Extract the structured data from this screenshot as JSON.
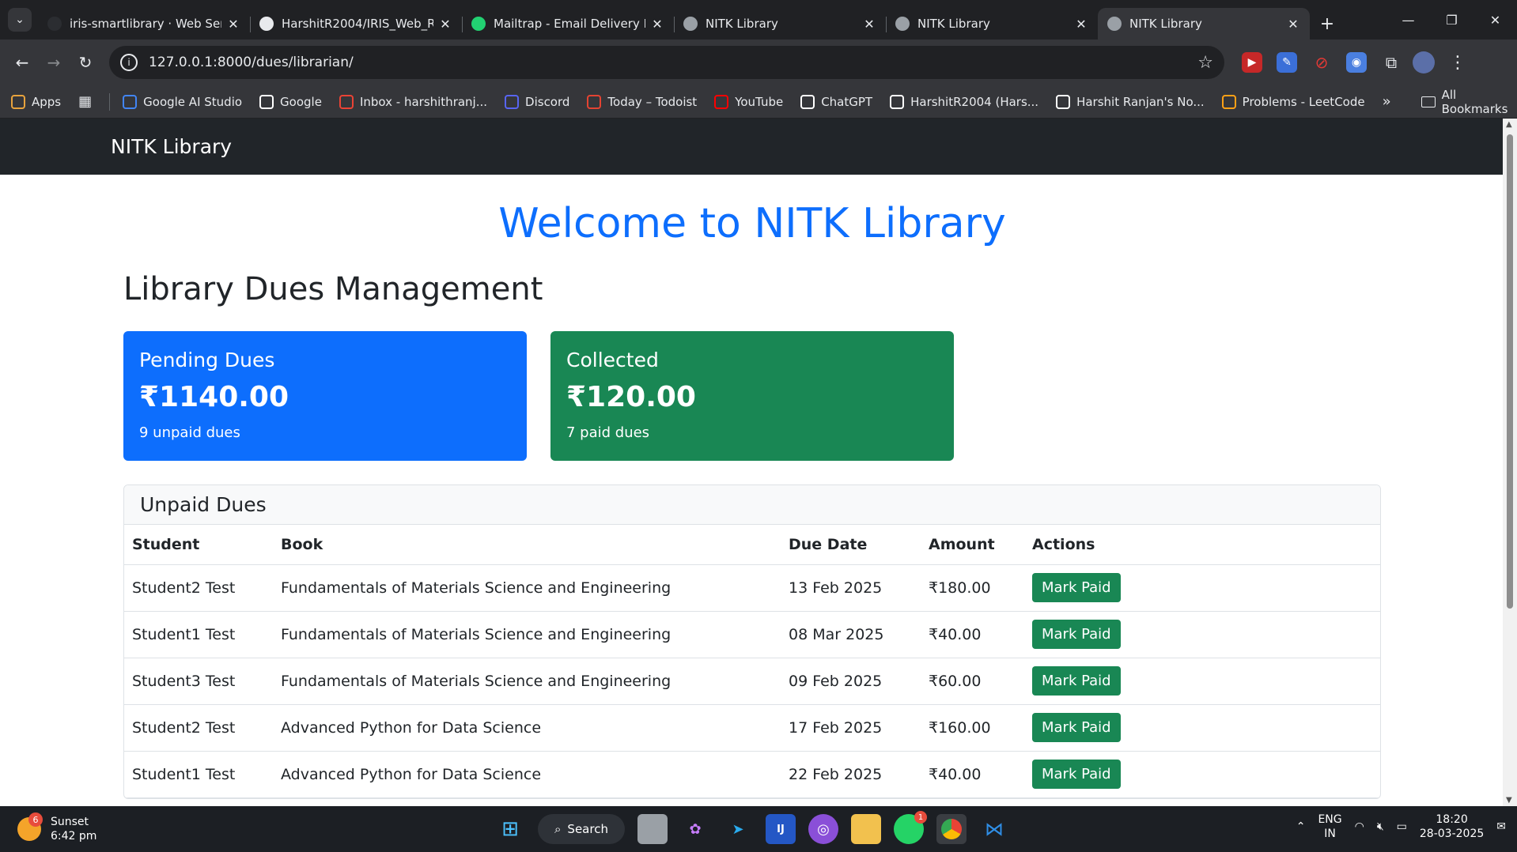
{
  "browser": {
    "tabs": [
      {
        "title": "iris-smartlibrary · Web Ser",
        "icon": "render-icon",
        "color": "#2b2d31",
        "active": false
      },
      {
        "title": "HarshitR2004/IRIS_Web_Re",
        "icon": "github-icon",
        "color": "#e8eaed",
        "active": false
      },
      {
        "title": "Mailtrap - Email Delivery P",
        "icon": "mailtrap-icon",
        "color": "#22d172",
        "active": false
      },
      {
        "title": "NITK Library",
        "icon": "globe-icon",
        "color": "#9aa0a6",
        "active": false
      },
      {
        "title": "NITK Library",
        "icon": "globe-icon",
        "color": "#9aa0a6",
        "active": false
      },
      {
        "title": "NITK Library",
        "icon": "globe-icon",
        "color": "#9aa0a6",
        "active": true
      }
    ],
    "url": "127.0.0.1:8000/dues/librarian/",
    "bookmarks": [
      {
        "label": "Apps",
        "icon": "apps-grid-icon",
        "color": "#e8a33d"
      },
      {
        "label": "Google AI Studio",
        "icon": "ai-studio-icon",
        "color": "#4285f4"
      },
      {
        "label": "Google",
        "icon": "google-icon",
        "color": "#ffffff"
      },
      {
        "label": "Inbox - harshithranj...",
        "icon": "gmail-icon",
        "color": "#ea4335"
      },
      {
        "label": "Discord",
        "icon": "discord-icon",
        "color": "#5865f2"
      },
      {
        "label": "Today – Todoist",
        "icon": "todoist-icon",
        "color": "#e44332"
      },
      {
        "label": "YouTube",
        "icon": "youtube-icon",
        "color": "#ff0000"
      },
      {
        "label": "ChatGPT",
        "icon": "chatgpt-icon",
        "color": "#ffffff"
      },
      {
        "label": "HarshitR2004 (Hars...",
        "icon": "github-icon",
        "color": "#ffffff"
      },
      {
        "label": "Harshit Ranjan's No...",
        "icon": "notion-icon",
        "color": "#ffffff"
      },
      {
        "label": "Problems - LeetCode",
        "icon": "leetcode-icon",
        "color": "#ffa116"
      }
    ],
    "all_bookmarks": "All Bookmarks"
  },
  "page": {
    "brand": "NITK Library",
    "welcome": "Welcome to NITK Library",
    "heading": "Library Dues Management",
    "cards": {
      "pending": {
        "title": "Pending Dues",
        "amount": "₹1140.00",
        "sub": "9 unpaid dues",
        "color": "#0d6efd"
      },
      "collected": {
        "title": "Collected",
        "amount": "₹120.00",
        "sub": "7 paid dues",
        "color": "#198754"
      }
    },
    "unpaid": {
      "title": "Unpaid Dues",
      "columns": [
        "Student",
        "Book",
        "Due Date",
        "Amount",
        "Actions"
      ],
      "rows": [
        {
          "student": "Student2 Test",
          "book": "Fundamentals of Materials Science and Engineering",
          "due": "13 Feb 2025",
          "amount": "₹180.00",
          "action": "Mark Paid"
        },
        {
          "student": "Student1 Test",
          "book": "Fundamentals of Materials Science and Engineering",
          "due": "08 Mar 2025",
          "amount": "₹40.00",
          "action": "Mark Paid"
        },
        {
          "student": "Student3 Test",
          "book": "Fundamentals of Materials Science and Engineering",
          "due": "09 Feb 2025",
          "amount": "₹60.00",
          "action": "Mark Paid"
        },
        {
          "student": "Student2 Test",
          "book": "Advanced Python for Data Science",
          "due": "17 Feb 2025",
          "amount": "₹160.00",
          "action": "Mark Paid"
        },
        {
          "student": "Student1 Test",
          "book": "Advanced Python for Data Science",
          "due": "22 Feb 2025",
          "amount": "₹40.00",
          "action": "Mark Paid"
        }
      ]
    }
  },
  "taskbar": {
    "weather": {
      "title": "Sunset",
      "time": "6:42 pm",
      "badge": "6"
    },
    "search": "Search",
    "whatsapp_badge": "1",
    "lang": {
      "line1": "ENG",
      "line2": "IN"
    },
    "clock": {
      "time": "18:20",
      "date": "28-03-2025"
    }
  }
}
